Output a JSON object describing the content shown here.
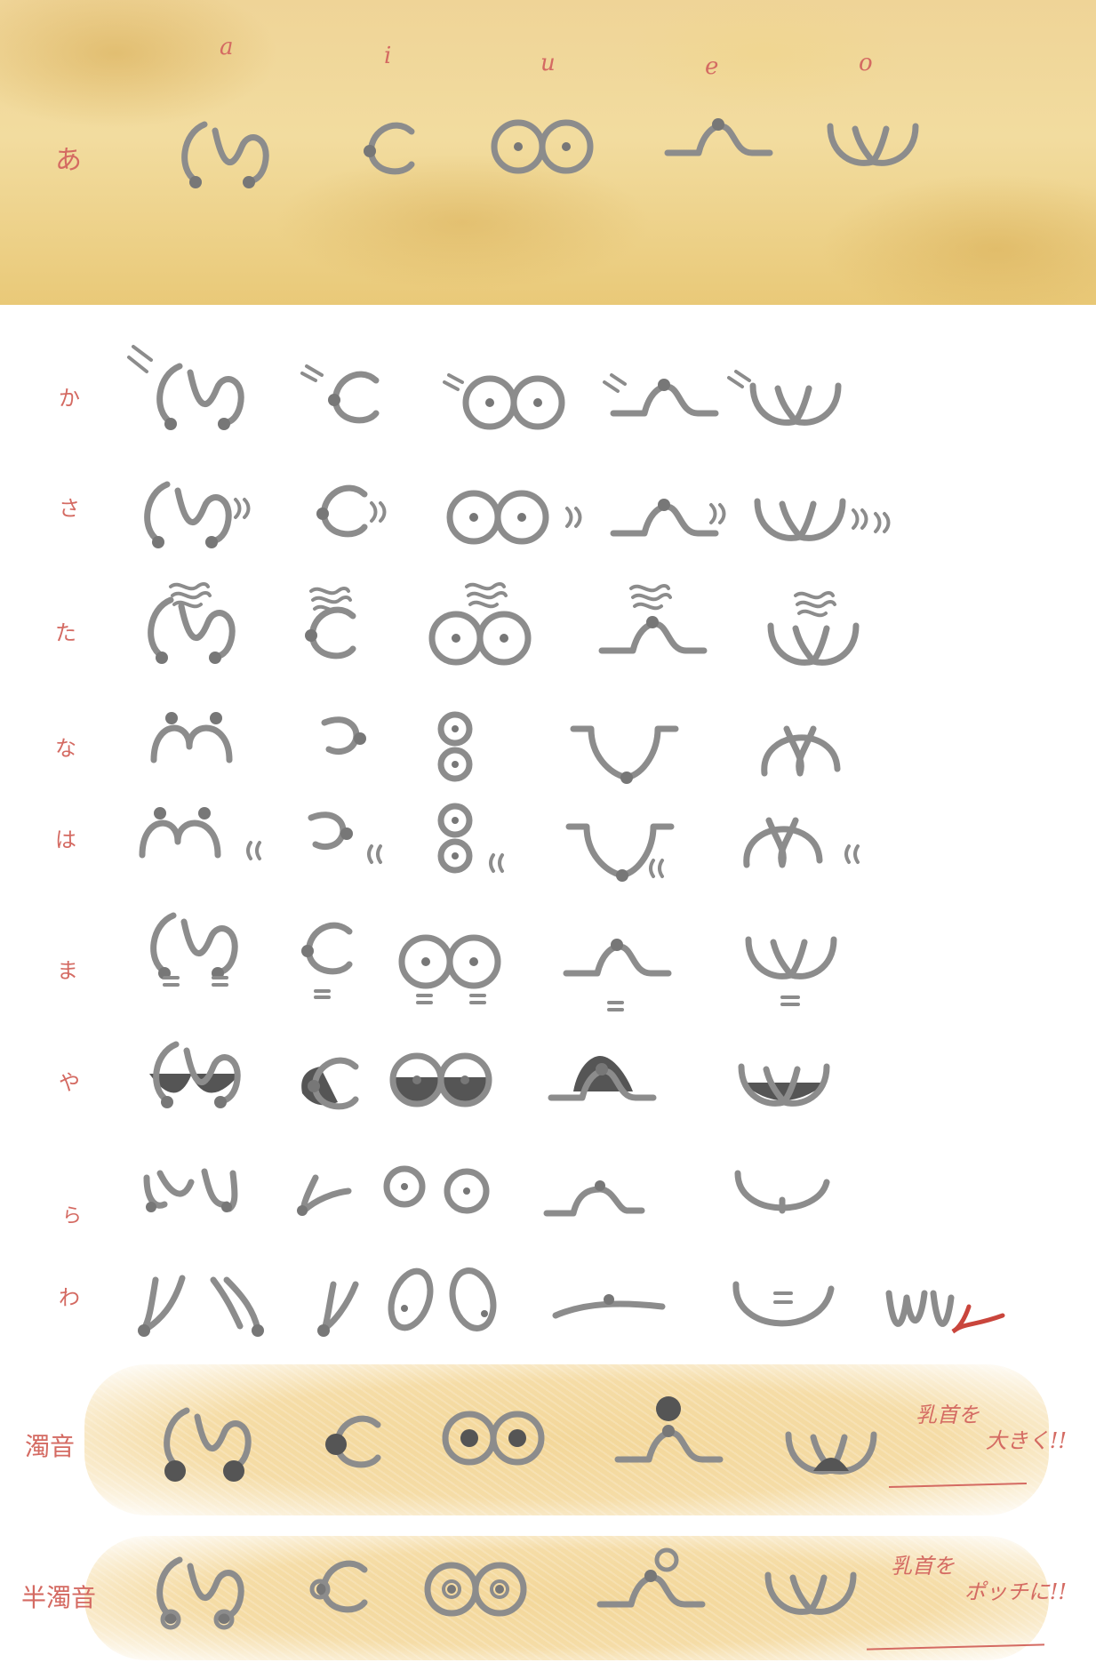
{
  "vowel_headers": [
    "a",
    "i",
    "u",
    "e",
    "o"
  ],
  "rows": [
    {
      "label": "あ"
    },
    {
      "label": "か"
    },
    {
      "label": "さ"
    },
    {
      "label": "た"
    },
    {
      "label": "な"
    },
    {
      "label": "は"
    },
    {
      "label": "ま"
    },
    {
      "label": "や"
    },
    {
      "label": "ら"
    },
    {
      "label": "わ"
    },
    {
      "label": "濁音"
    },
    {
      "label": "半濁音"
    }
  ],
  "notes": {
    "dakuon_line1": "乳首を",
    "dakuon_line2": "大きく!!",
    "handakuon_line1": "乳首を",
    "handakuon_line2": "ポッチに!!"
  },
  "colors": {
    "band_top": "#efd497",
    "band_rows": "#f3d79a",
    "label_red": "#d46a62",
    "stroke_gray": "#8c8c8c",
    "fill_dark": "#555555"
  }
}
